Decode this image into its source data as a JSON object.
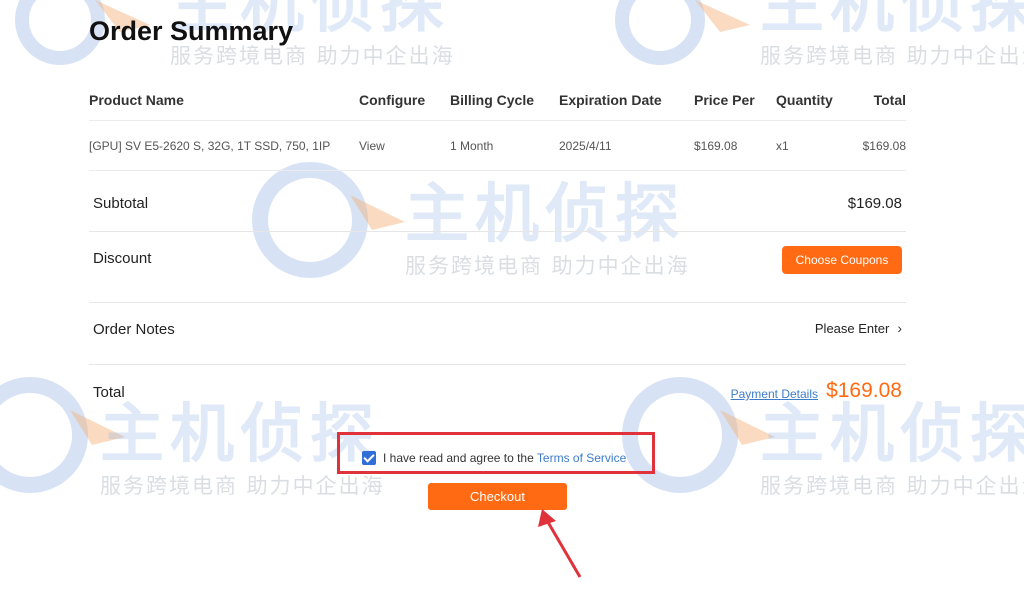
{
  "page": {
    "title": "Order Summary"
  },
  "table": {
    "headers": {
      "product": "Product Name",
      "configure": "Configure",
      "billing": "Billing Cycle",
      "expiration": "Expiration Date",
      "price": "Price Per",
      "quantity": "Quantity",
      "total": "Total"
    },
    "rows": [
      {
        "product": "[GPU] SV E5-2620 S, 32G, 1T SSD, 750, 1IP",
        "configure": "View",
        "billing": "1 Month",
        "expiration": "2025/4/11",
        "price": "$169.08",
        "quantity": "x1",
        "total": "$169.08"
      }
    ]
  },
  "summary": {
    "subtotal_label": "Subtotal",
    "subtotal_value": "$169.08",
    "discount_label": "Discount",
    "coupon_button": "Choose Coupons",
    "notes_label": "Order Notes",
    "notes_action": "Please Enter",
    "total_label": "Total",
    "payment_details": "Payment Details",
    "total_value": "$169.08"
  },
  "agreement": {
    "checked": true,
    "text": "I have read and agree to the",
    "link": "Terms of Service"
  },
  "checkout_button": "Checkout",
  "watermark": {
    "brand": "主机侦探",
    "slogan": "服务跨境电商 助力中企出海"
  },
  "colors": {
    "accent": "#ff6a13",
    "link": "#3d7cc9",
    "highlight": "#e0323a",
    "checkbox": "#2f6fd6"
  },
  "icons": {
    "notes_chevron": "chevron-right-icon",
    "checkbox": "checkbox-checked-icon",
    "annotation": "red-arrow-annotation"
  }
}
